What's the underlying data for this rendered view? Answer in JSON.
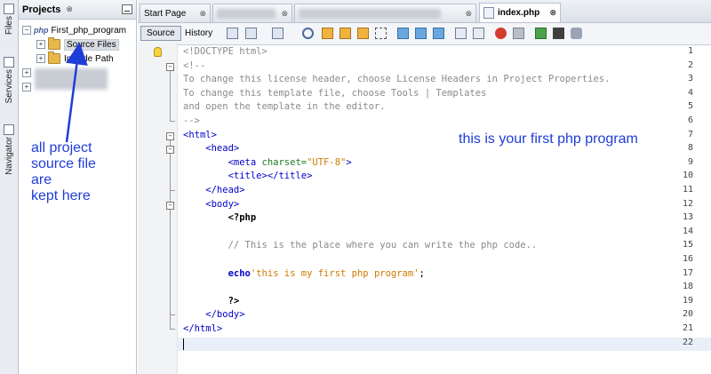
{
  "side_tabs": [
    {
      "label": "Files",
      "icon": "files-icon"
    },
    {
      "label": "Services",
      "icon": "services-icon"
    },
    {
      "label": "Navigator",
      "icon": "navigator-icon"
    }
  ],
  "projects_panel": {
    "title": "Projects",
    "close_glyph": "⊗",
    "tree": {
      "root": "First_php_program",
      "children": [
        "Source Files",
        "Include Path"
      ]
    }
  },
  "annotations": {
    "left_lines": [
      "all project",
      "source file",
      "are",
      "kept here"
    ],
    "right": "this is your first php program"
  },
  "editor_tabs": [
    {
      "label": "Start Page",
      "active": false
    },
    {
      "label": "",
      "active": false,
      "blurred": true
    },
    {
      "label": "",
      "active": false,
      "blurred": true
    },
    {
      "label": "index.php",
      "active": true
    }
  ],
  "toolbar": {
    "source_label": "Source",
    "history_label": "History"
  },
  "code_lines": [
    {
      "n": "1",
      "text": "<!DOCTYPE html>",
      "cls": "cmt"
    },
    {
      "n": "2",
      "text": "<!--",
      "cls": "cmt"
    },
    {
      "n": "3",
      "text": "To change this license header, choose License Headers in Project Properties.",
      "cls": "cmt"
    },
    {
      "n": "4",
      "text": "To change this template file, choose Tools | Templates",
      "cls": "cmt"
    },
    {
      "n": "5",
      "text": "and open the template in the editor.",
      "cls": "cmt"
    },
    {
      "n": "6",
      "text": "-->",
      "cls": "cmt"
    },
    {
      "n": "7",
      "text": "<html>",
      "cls": "tag"
    },
    {
      "n": "8",
      "text": "    <head>",
      "cls": "tag"
    },
    {
      "n": "9",
      "text": "        <meta charset=\"UTF-8\">",
      "cls": "meta"
    },
    {
      "n": "10",
      "text": "        <title></title>",
      "cls": "tag"
    },
    {
      "n": "11",
      "text": "    </head>",
      "cls": "tag"
    },
    {
      "n": "12",
      "text": "    <body>",
      "cls": "tag"
    },
    {
      "n": "13",
      "text": "        <?php",
      "cls": "php"
    },
    {
      "n": "14",
      "text": "",
      "cls": ""
    },
    {
      "n": "15",
      "text": "        // This is the place where you can write the php code..",
      "cls": "cmt"
    },
    {
      "n": "16",
      "text": "",
      "cls": ""
    },
    {
      "n": "17",
      "text": "        echo'this is my first php program';",
      "cls": "echo"
    },
    {
      "n": "18",
      "text": "",
      "cls": ""
    },
    {
      "n": "19",
      "text": "        ?>",
      "cls": "php"
    },
    {
      "n": "20",
      "text": "    </body>",
      "cls": "tag"
    },
    {
      "n": "21",
      "text": "</html>",
      "cls": "tag"
    },
    {
      "n": "22",
      "text": "",
      "cls": ""
    }
  ],
  "colors": {
    "annotation": "#1f3dd8",
    "tag": "#0000c8",
    "string": "#ce7b00",
    "comment": "#8a8a8a"
  }
}
